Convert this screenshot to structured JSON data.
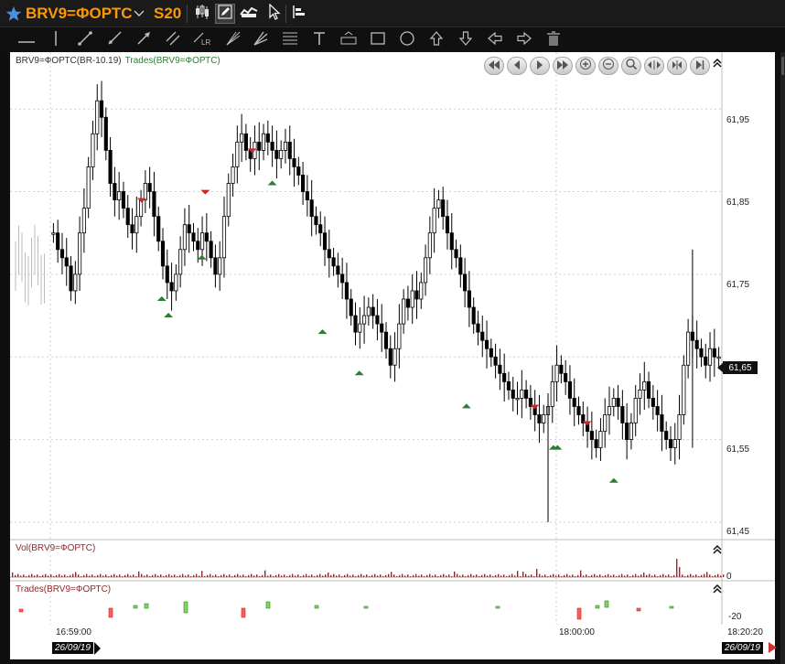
{
  "title": {
    "instrument": "BRV9=ФОРТС",
    "timeframe": "S20",
    "colors": {
      "accent": "#ff9800",
      "star": "#4a90e2"
    }
  },
  "toolbar": {
    "icons": [
      "chart-type-icon",
      "edit-icon",
      "compare-icon",
      "cursor-icon",
      "indicators-icon"
    ]
  },
  "drawing_tools": [
    "horizontal-line-icon",
    "vertical-line-icon",
    "segment-icon",
    "ray-icon",
    "arrow-line-icon",
    "parallel-lines-icon",
    "linear-regression-icon",
    "fan-icon",
    "pitchfork-icon",
    "fibonacci-icon",
    "text-icon",
    "price-label-icon",
    "rectangle-icon",
    "ellipse-icon",
    "arrow-up-icon",
    "arrow-down-icon",
    "arrow-left-icon",
    "arrow-right-icon",
    "trash-icon"
  ],
  "chart": {
    "main_legend": "BRV9=ФОРТС(BR-10.19)",
    "trades_legend": "Trades(BRV9=ФОРТС)",
    "vol_legend": "Vol(BRV9=ФОРТС)",
    "trades_pane_legend": "Trades(BRV9=ФОРТС)",
    "price_labels": [
      "61,95",
      "61,85",
      "61,75",
      "61,65",
      "61,55",
      "61,45"
    ],
    "last_price": "61,65",
    "vol_zero": "0",
    "trades_scale": "-20",
    "time_labels": [
      "16:59:00",
      "18:00:00",
      "18:20:20"
    ],
    "date_badges": [
      "26/09/19",
      "26/09/19"
    ]
  },
  "chart_data": {
    "type": "candlestick",
    "ylim": [
      61.43,
      62.01
    ],
    "y_ticks": [
      61.45,
      61.55,
      61.65,
      61.75,
      61.85,
      61.95
    ],
    "close_series": [
      61.8,
      61.78,
      61.77,
      61.76,
      61.73,
      61.75,
      61.8,
      61.83,
      61.88,
      61.92,
      61.96,
      61.94,
      61.9,
      61.86,
      61.84,
      61.85,
      61.83,
      61.81,
      61.8,
      61.82,
      61.84,
      61.86,
      61.85,
      61.82,
      61.79,
      61.76,
      61.74,
      61.73,
      61.75,
      61.78,
      61.81,
      61.8,
      61.79,
      61.78,
      61.8,
      61.79,
      61.77,
      61.75,
      61.77,
      61.82,
      61.86,
      61.88,
      61.91,
      61.92,
      61.9,
      61.89,
      61.91,
      61.9,
      61.92,
      61.91,
      61.9,
      61.89,
      61.9,
      61.91,
      61.89,
      61.88,
      61.87,
      61.85,
      61.84,
      61.82,
      61.81,
      61.8,
      61.78,
      61.77,
      61.76,
      61.75,
      61.74,
      61.72,
      61.7,
      61.68,
      61.69,
      61.7,
      61.71,
      61.7,
      61.69,
      61.68,
      61.66,
      61.64,
      61.66,
      61.69,
      61.72,
      61.71,
      61.73,
      61.72,
      61.74,
      61.77,
      61.8,
      61.83,
      61.84,
      61.82,
      61.8,
      61.78,
      61.77,
      61.75,
      61.73,
      61.71,
      61.69,
      61.68,
      61.67,
      61.66,
      61.65,
      61.64,
      61.63,
      61.62,
      61.61,
      61.6,
      61.6,
      61.61,
      61.6,
      61.59,
      61.58,
      61.57,
      61.58,
      61.59,
      61.62,
      61.64,
      61.63,
      61.62,
      61.6,
      61.59,
      61.58,
      61.57,
      61.56,
      61.55,
      61.54,
      61.56,
      61.58,
      61.59,
      61.6,
      61.59,
      61.57,
      61.55,
      61.57,
      61.6,
      61.61,
      61.62,
      61.6,
      61.59,
      61.58,
      61.56,
      61.55,
      61.54,
      61.55,
      61.58,
      61.64,
      61.68,
      61.67,
      61.66,
      61.65,
      61.64,
      61.66,
      61.65,
      61.65
    ],
    "buy_markers": [
      [
        0.165,
        61.73
      ],
      [
        0.175,
        61.71
      ],
      [
        0.225,
        61.78
      ],
      [
        0.33,
        61.87
      ],
      [
        0.405,
        61.69
      ],
      [
        0.46,
        61.64
      ],
      [
        0.62,
        61.6
      ],
      [
        0.75,
        61.55
      ],
      [
        0.756,
        61.55
      ],
      [
        0.84,
        61.51
      ]
    ],
    "sell_markers": [
      [
        0.135,
        61.83
      ],
      [
        0.23,
        61.84
      ],
      [
        0.3,
        61.89
      ],
      [
        0.722,
        61.58
      ],
      [
        0.8,
        61.56
      ]
    ],
    "volume_colors": {
      "bar": "#8b2c2c"
    },
    "trade_colors": {
      "buy": "#2e7d32",
      "sell": "#c62828"
    }
  }
}
